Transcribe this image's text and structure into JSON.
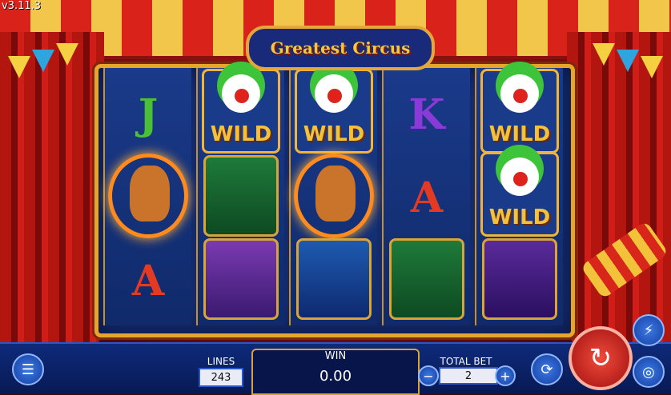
{
  "version": "v3.11.3",
  "title": "Greatest Circus",
  "reels": [
    [
      {
        "type": "letter",
        "value": "J",
        "color": "#4bbf35"
      },
      {
        "type": "tiger",
        "value": ""
      },
      {
        "type": "letter",
        "value": "A",
        "color": "#e33a24"
      }
    ],
    [
      {
        "type": "wild",
        "value": "WILD"
      },
      {
        "type": "rabbit",
        "value": ""
      },
      {
        "type": "elephant",
        "value": ""
      }
    ],
    [
      {
        "type": "wild",
        "value": "WILD"
      },
      {
        "type": "tiger",
        "value": ""
      },
      {
        "type": "seal",
        "value": ""
      }
    ],
    [
      {
        "type": "letter",
        "value": "K",
        "color": "#8a3ad6"
      },
      {
        "type": "letter",
        "value": "A",
        "color": "#e33a24"
      },
      {
        "type": "rabbit",
        "value": ""
      }
    ],
    [
      {
        "type": "wild",
        "value": "WILD"
      },
      {
        "type": "wild",
        "value": "WILD"
      },
      {
        "type": "bear",
        "value": ""
      }
    ]
  ],
  "bottom": {
    "lines_label": "LINES",
    "lines_value": "243",
    "win_label": "WIN",
    "win_value": "0.00",
    "total_bet_label": "TOTAL BET",
    "total_bet_value": "2",
    "minus_label": "−",
    "plus_label": "+"
  },
  "icons": {
    "menu": "menu-icon",
    "autoplay": "autoplay-icon",
    "turbo": "lightning-icon",
    "coins": "coin-stack-icon",
    "spin": "spin-icon"
  },
  "colors": {
    "accent_gold": "#e7a62a",
    "reel_blue": "#132a6e",
    "spin_red": "#d8261a"
  }
}
